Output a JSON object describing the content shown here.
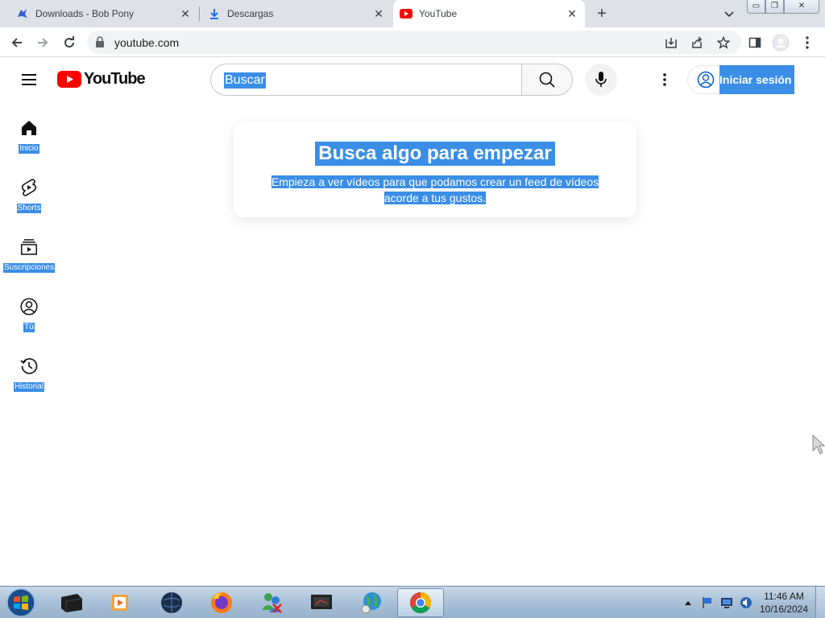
{
  "browser": {
    "tabs": [
      {
        "title": "Downloads - Bob Pony",
        "icon": "bob-pony-icon",
        "active": false
      },
      {
        "title": "Descargas",
        "icon": "download-icon",
        "active": false
      },
      {
        "title": "YouTube",
        "icon": "youtube-icon",
        "active": true
      }
    ],
    "new_tab_label": "+",
    "url": "youtube.com",
    "window_buttons": {
      "minimize": "▭",
      "restore": "❐",
      "close": "✕"
    }
  },
  "youtube": {
    "logo_text": "YouTube",
    "search_placeholder": "Buscar",
    "sign_in_label": "Iniciar sesión",
    "sidebar": [
      {
        "label": "Inicio",
        "icon": "home-icon"
      },
      {
        "label": "Shorts",
        "icon": "shorts-icon"
      },
      {
        "label": "Suscripciones",
        "icon": "subscriptions-icon"
      },
      {
        "label": "Tú",
        "icon": "you-icon"
      },
      {
        "label": "Historial",
        "icon": "history-icon"
      }
    ],
    "empty_state": {
      "title": "Busca algo para empezar",
      "description": "Empieza a ver vídeos para que podamos crear un feed de vídeos acorde a tus gustos."
    },
    "brand_color": "#ff0000",
    "selection_color": "#3a8ee6"
  },
  "taskbar": {
    "apps": [
      "terminal-app",
      "media-player-app",
      "dark-globe-app",
      "firefox-app",
      "messenger-app",
      "monitor-app",
      "network-globe-app",
      "chrome-app"
    ],
    "active_app": "chrome-app",
    "clock_time": "11:46 AM",
    "clock_date": "10/16/2024"
  }
}
